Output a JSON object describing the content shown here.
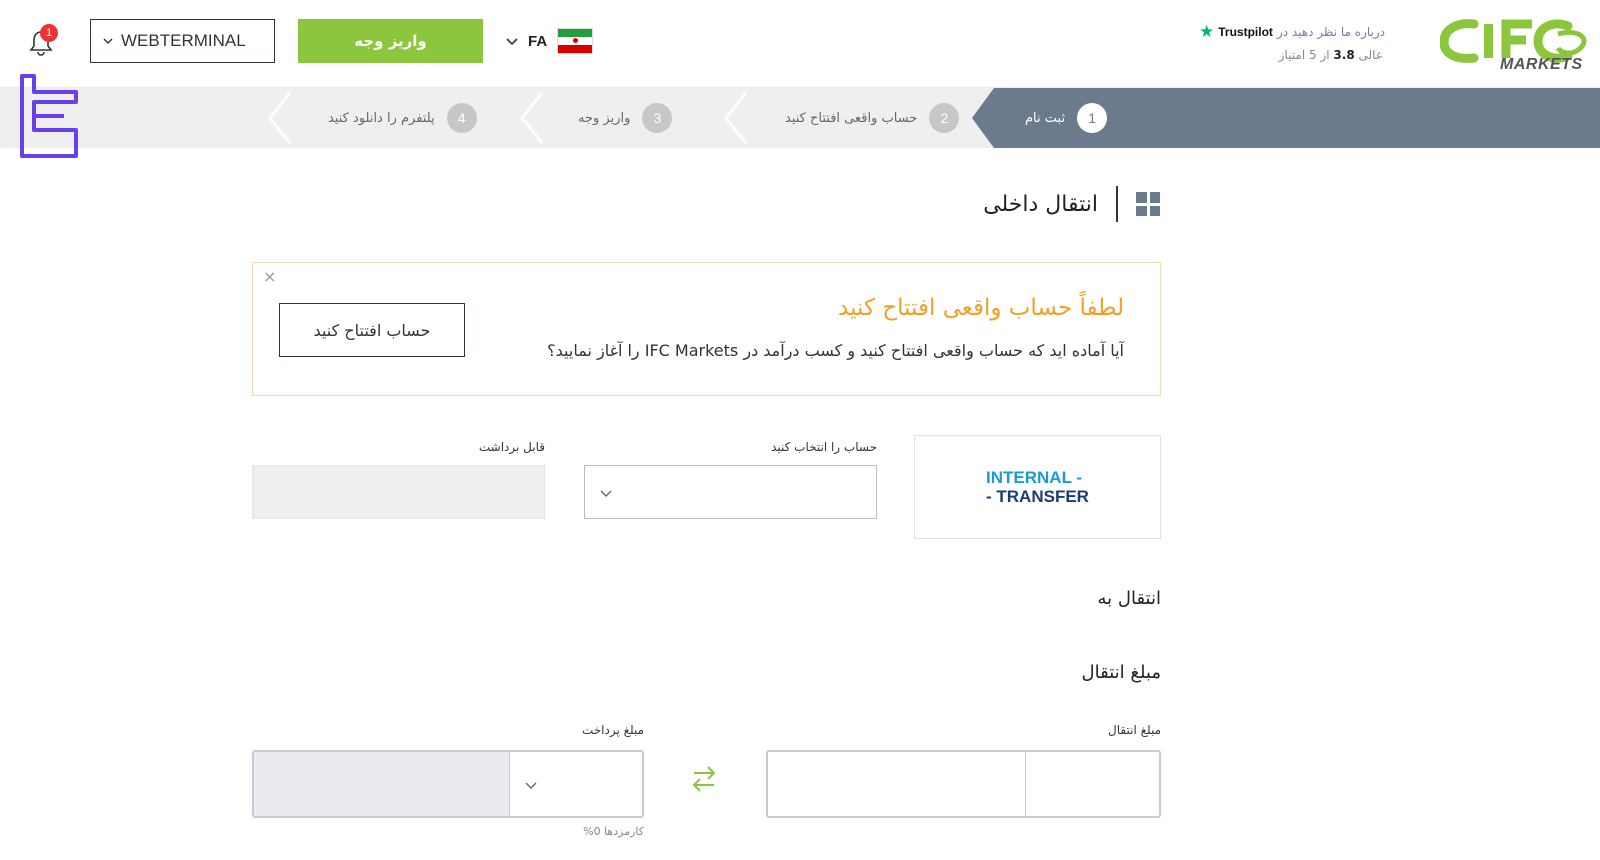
{
  "header": {
    "notification_count": "1",
    "terminal_select": "WEBTERMINAL",
    "deposit_button": "واریز وجه",
    "language": "FA",
    "trustpilot": {
      "prompt": "درباره ما نظر دهید در",
      "brand": "Trustpilot",
      "rating_word": "عالی",
      "score": "3.8",
      "rating_suffix": "از 5 امتیاز"
    },
    "logo_text": "MARKETS"
  },
  "steps": [
    {
      "num": "1",
      "label": "ثبت نام",
      "active": true
    },
    {
      "num": "2",
      "label": "حساب واقعی افتتاح کنید",
      "active": false
    },
    {
      "num": "3",
      "label": "واریز وجه",
      "active": false
    },
    {
      "num": "4",
      "label": "پلتفرم را دانلود کنید",
      "active": false
    }
  ],
  "page": {
    "title": "انتقال داخلی"
  },
  "notice": {
    "close": "×",
    "title": "لطفاً حساب واقعی افتتاح کنید",
    "text": "آیا آماده اید که حساب واقعی افتتاح کنید و کسب درآمد در IFC Markets را آغاز نمایید؟",
    "button": "حساب افتتاح کنید"
  },
  "method": {
    "logo_line1": "INTERNAL -",
    "logo_line2": "- TRANSFER"
  },
  "form": {
    "select_account_label": "حساب را انتخاب کنید",
    "select_account_value": "",
    "withdrawable_label": "قابل برداشت",
    "withdrawable_value": "",
    "transfer_to_heading": "انتقال به",
    "transfer_amount_heading": "مبلغ انتقال",
    "transfer_amount_label": "مبلغ انتقال",
    "payment_amount_label": "مبلغ پرداخت",
    "fees": "کارمزدها 0%"
  },
  "colors": {
    "accent_green": "#8cc63f",
    "steps_active": "#6c7a8e",
    "notice_orange": "#f0a028",
    "notice_border": "#f2dcb8",
    "badge_red": "#e33333"
  },
  "icons": [
    "bell-icon",
    "chevron-down-icon",
    "flag-iran-icon",
    "trustpilot-star-icon",
    "grid-icon",
    "close-icon",
    "swap-arrows-icon"
  ]
}
